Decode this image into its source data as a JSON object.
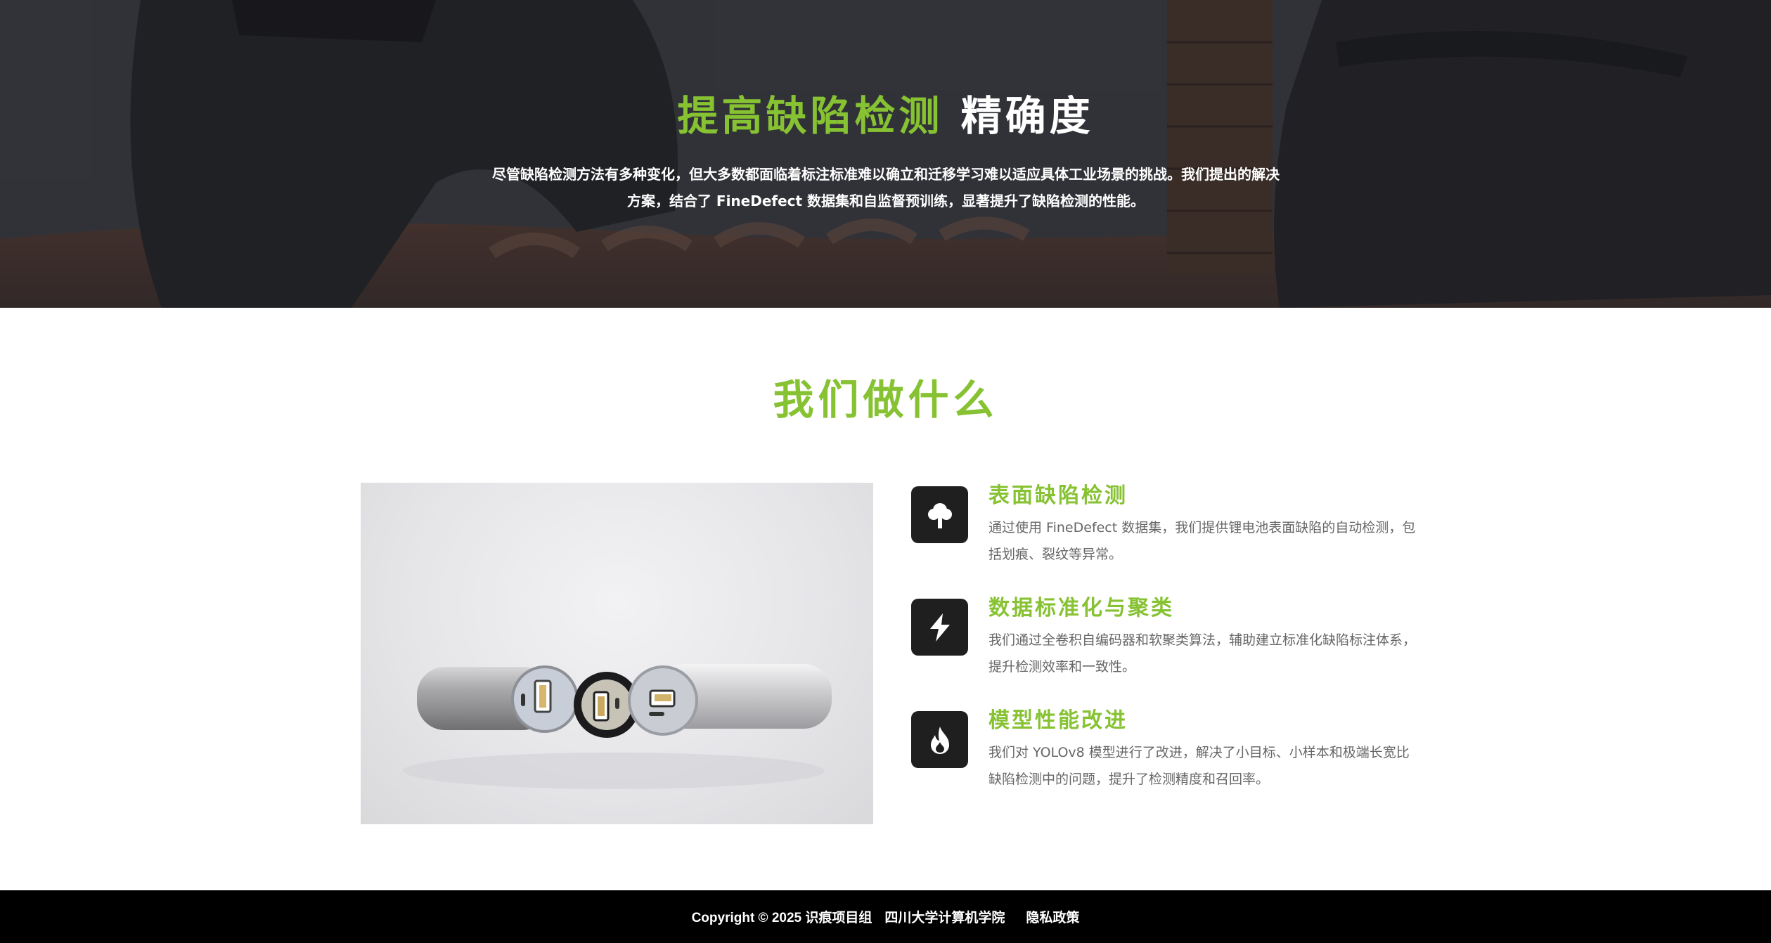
{
  "hero": {
    "title_highlight": "提高缺陷检测",
    "title_rest": "精确度",
    "description": "尽管缺陷检测方法有多种变化，但大多数都面临着标注标准难以确立和迁移学习难以适应具体工业场景的挑战。我们提出的解决方案，结合了 FineDefect 数据集和自监督预训练，显著提升了缺陷检测的性能。"
  },
  "section": {
    "title": "我们做什么"
  },
  "features": [
    {
      "icon": "tree-icon",
      "title": "表面缺陷检测",
      "description": "通过使用 FineDefect 数据集，我们提供锂电池表面缺陷的自动检测，包括划痕、裂纹等异常。"
    },
    {
      "icon": "bolt-icon",
      "title": "数据标准化与聚类",
      "description": "我们通过全卷积自编码器和软聚类算法，辅助建立标准化缺陷标注体系，提升检测效率和一致性。"
    },
    {
      "icon": "fire-icon",
      "title": "模型性能改进",
      "description": "我们对 YOLOv8 模型进行了改进，解决了小目标、小样本和极端长宽比缺陷检测中的问题，提升了检测精度和召回率。"
    }
  ],
  "footer": {
    "copyright": "Copyright © 2025 识痕项目组",
    "org": "四川大学计算机学院",
    "privacy": "隐私政策"
  },
  "colors": {
    "accent": "#86c232",
    "icon_bg": "#1f1f1f",
    "footer_bg": "#000000"
  }
}
